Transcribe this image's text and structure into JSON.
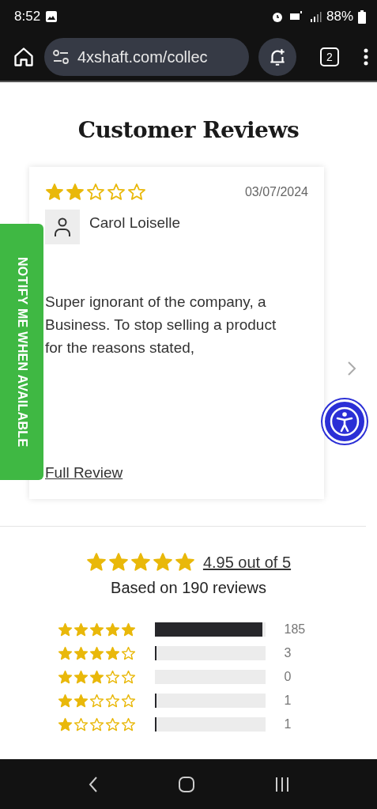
{
  "status_bar": {
    "time": "8:52",
    "battery": "88%"
  },
  "browser": {
    "url": "4xshaft.com/collec",
    "tab_count": "2"
  },
  "title": "Customer Reviews",
  "review": {
    "stars": 2,
    "date": "03/07/2024",
    "author": "Carol Loiselle",
    "body": "Super ignorant of the company, a Business. To stop selling a product for the reasons stated,",
    "link": "Full Review"
  },
  "notify_tab": "NOTIFY ME WHEN AVAILABLE",
  "summary": {
    "stars": 5,
    "average": "4.95 out of 5",
    "based_on": "Based on 190 reviews"
  },
  "histogram": [
    {
      "stars": 5,
      "level": 0.974,
      "count": "185"
    },
    {
      "stars": 4,
      "level": 0.016,
      "count": "3"
    },
    {
      "stars": 3,
      "level": 0,
      "count": "0"
    },
    {
      "stars": 2,
      "level": 0.005,
      "count": "1"
    },
    {
      "stars": 1,
      "level": 0.005,
      "count": "1"
    }
  ]
}
